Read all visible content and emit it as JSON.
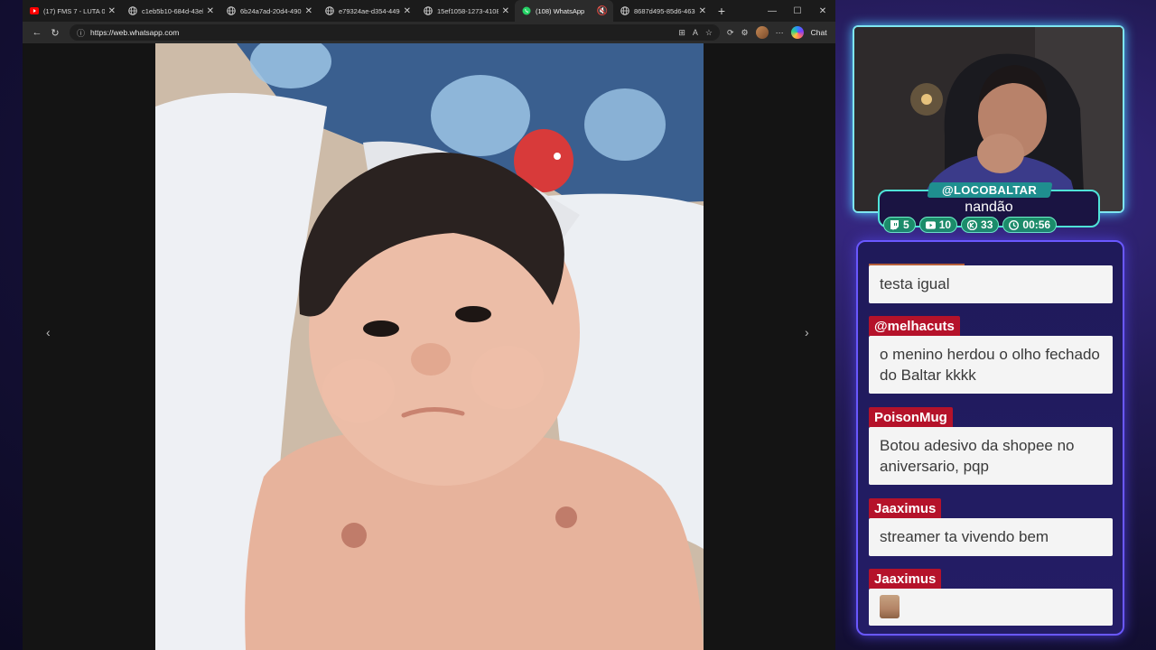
{
  "browser": {
    "tabs": [
      {
        "title": "(17) FMS 7 - LUTA 09",
        "icon": "youtube-icon",
        "active": false
      },
      {
        "title": "c1eb5b10-684d-43eb-",
        "icon": "globe-icon",
        "active": false
      },
      {
        "title": "6b24a7ad-20d4-4902-",
        "icon": "globe-icon",
        "active": false
      },
      {
        "title": "e79324ae-d354-449e-",
        "icon": "globe-icon",
        "active": false
      },
      {
        "title": "15ef1058-1273-4108-",
        "icon": "globe-icon",
        "active": false
      },
      {
        "title": "(108) WhatsApp",
        "icon": "whatsapp-icon",
        "active": true
      },
      {
        "title": "8687d495-85d6-4636-",
        "icon": "globe-icon",
        "active": false
      }
    ],
    "url": "https://web.whatsapp.com",
    "chat_label": "Chat",
    "colors": {
      "youtube": "#ff0000",
      "whatsapp": "#25d366"
    }
  },
  "stream": {
    "handle": "@LOCOBALTAR",
    "name": "nandão",
    "stats": {
      "twitch": "5",
      "youtube": "10",
      "kick": "33",
      "time": "00:56"
    }
  },
  "chat": {
    "messages": [
      {
        "user": "",
        "text": "testa igual"
      },
      {
        "user": "@melhacuts",
        "text": "o menino herdou o olho fechado do Baltar kkkk"
      },
      {
        "user": "PoisonMug",
        "text": "Botou adesivo da shopee no aniversario, pqp"
      },
      {
        "user": "Jaaximus",
        "text": "streamer ta vivendo bem"
      },
      {
        "user": "Jaaximus",
        "text": ""
      }
    ]
  }
}
